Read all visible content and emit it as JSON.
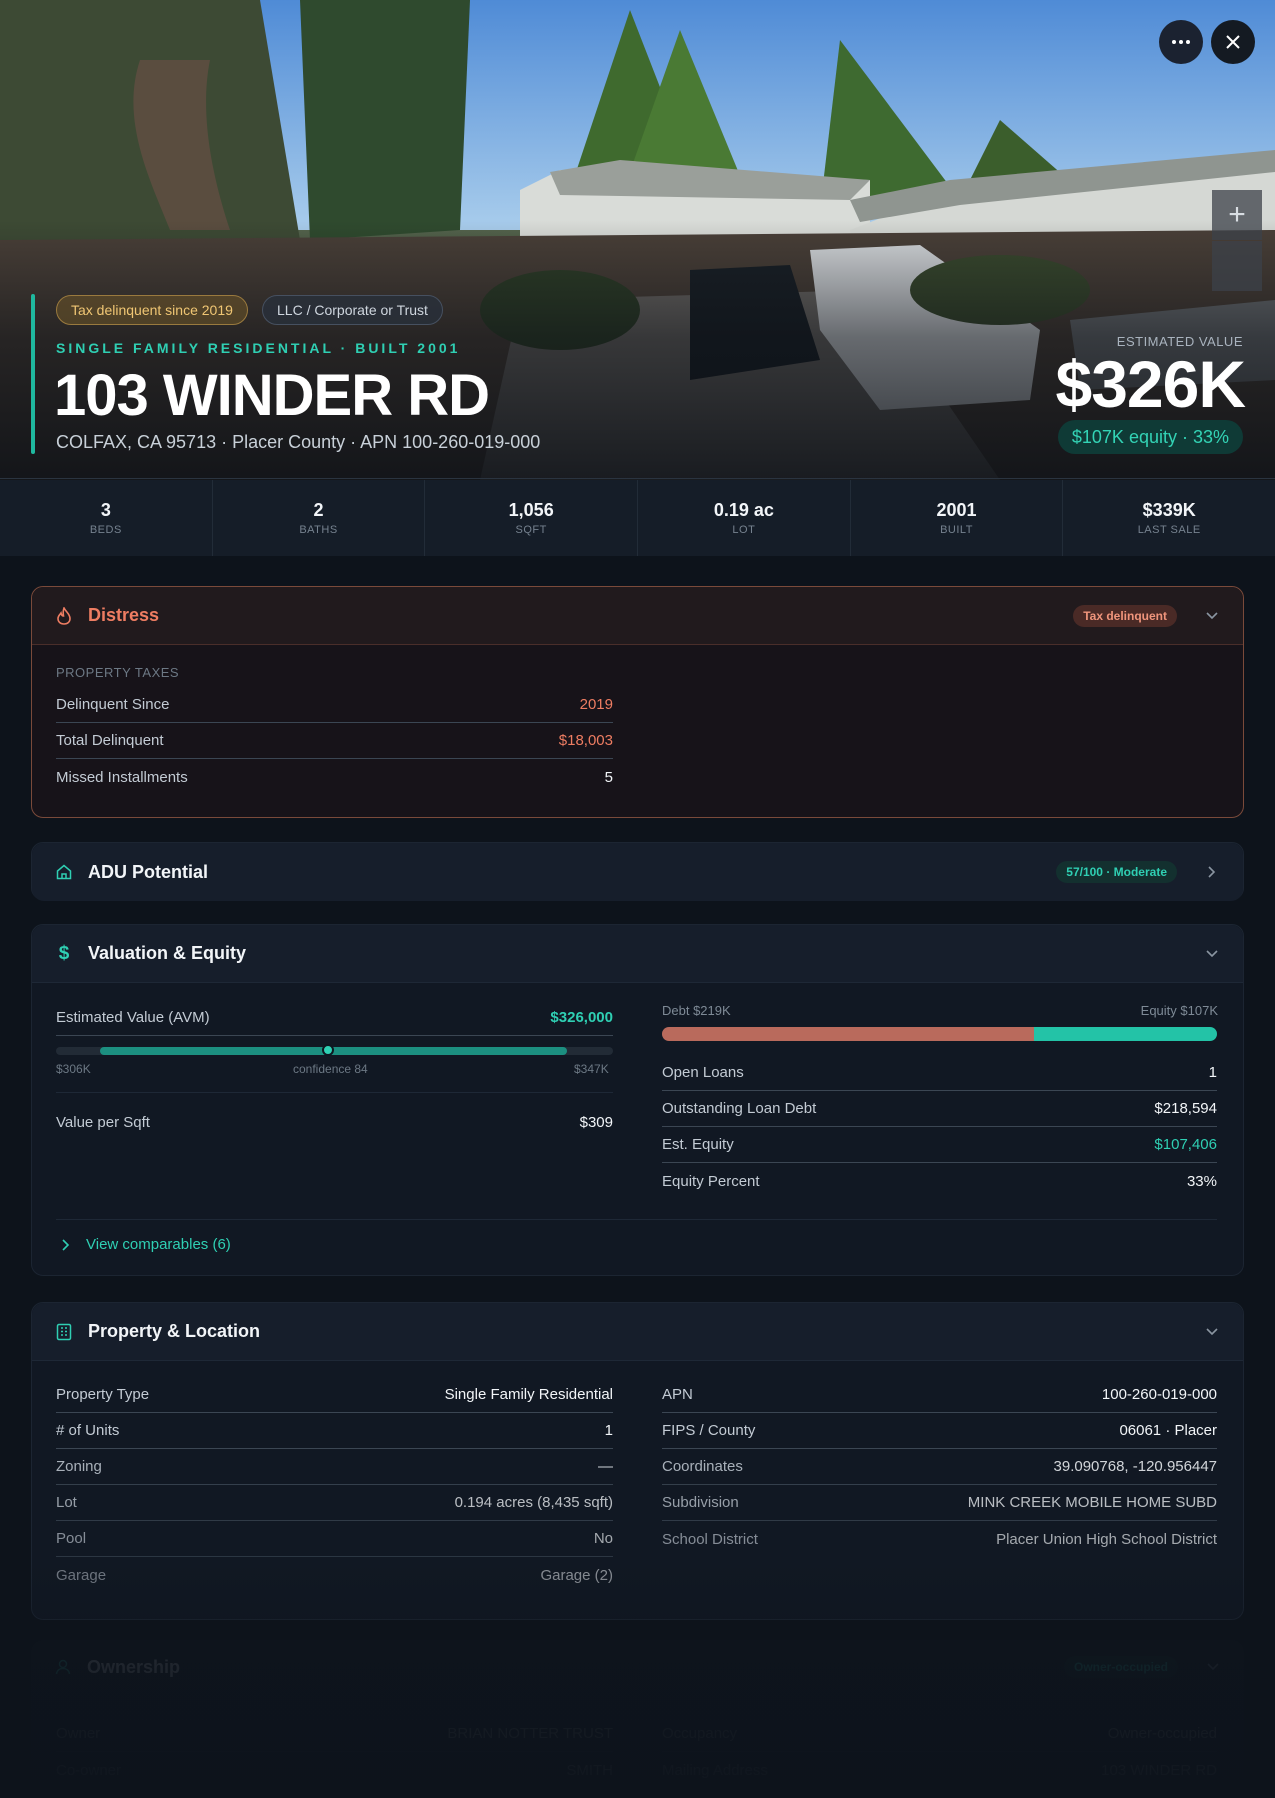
{
  "hero": {
    "tags": {
      "tax": "Tax delinquent since 2019",
      "owner_type": "LLC / Corporate or Trust"
    },
    "eyebrow": "SINGLE FAMILY RESIDENTIAL · BUILT 2001",
    "address": "103 WINDER RD",
    "subtitle": "COLFAX, CA 95713 · Placer County · APN 100-260-019-000",
    "estimated_label": "ESTIMATED VALUE",
    "estimated_value": "$326K",
    "equity_pill": "$107K equity · 33%"
  },
  "stats": [
    {
      "value": "3",
      "label": "BEDS"
    },
    {
      "value": "2",
      "label": "BATHS"
    },
    {
      "value": "1,056",
      "label": "SQFT"
    },
    {
      "value": "0.19 ac",
      "label": "LOT"
    },
    {
      "value": "2001",
      "label": "BUILT"
    },
    {
      "value": "$339K",
      "label": "LAST SALE"
    }
  ],
  "distress": {
    "title": "Distress",
    "badge": "Tax delinquent",
    "section": "PROPERTY TAXES",
    "rows": [
      {
        "k": "Delinquent Since",
        "v": "2019"
      },
      {
        "k": "Total Delinquent",
        "v": "$18,003"
      },
      {
        "k": "Missed Installments",
        "v": "5"
      }
    ]
  },
  "adu": {
    "title": "ADU Potential",
    "badge": "57/100 · Moderate"
  },
  "valuation": {
    "title": "Valuation & Equity",
    "avm_label": "Estimated Value (AVM)",
    "avm_value": "$326,000",
    "range_low": "$306K",
    "range_high": "$347K",
    "confidence": "confidence 84",
    "confidence_score": 84,
    "vps_label": "Value per Sqft",
    "vps_value": "$309",
    "debt_label": "Debt $219K",
    "equity_label": "Equity $107K",
    "debt_fraction": 0.67,
    "rows": [
      {
        "k": "Open Loans",
        "v": "1"
      },
      {
        "k": "Outstanding Loan Debt",
        "v": "$218,594"
      },
      {
        "k": "Est. Equity",
        "v": "$107,406"
      },
      {
        "k": "Equity Percent",
        "v": "33%"
      }
    ],
    "comparables_link": "View comparables (6)"
  },
  "property": {
    "title": "Property & Location",
    "left": [
      {
        "k": "Property Type",
        "v": "Single Family Residential"
      },
      {
        "k": "# of Units",
        "v": "1"
      },
      {
        "k": "Zoning",
        "v": "—"
      },
      {
        "k": "Lot",
        "v": "0.194 acres (8,435 sqft)"
      },
      {
        "k": "Pool",
        "v": "No"
      },
      {
        "k": "Garage",
        "v": "Garage (2)"
      }
    ],
    "right": [
      {
        "k": "APN",
        "v": "100-260-019-000"
      },
      {
        "k": "FIPS / County",
        "v": "06061 · Placer"
      },
      {
        "k": "Coordinates",
        "v": "39.090768, -120.956447"
      },
      {
        "k": "Subdivision",
        "v": "MINK CREEK MOBILE HOME SUBD"
      },
      {
        "k": "School District",
        "v": "Placer Union High School District"
      }
    ]
  },
  "ownership": {
    "title": "Ownership",
    "badge": "Owner-occupied",
    "rows": [
      {
        "k": "Owner",
        "v": "BRIAN NOTTER TRUST",
        "k2": "Occupancy",
        "v2": "Owner-occupied"
      },
      {
        "k": "Co-owner",
        "v": "SMITH",
        "k2": "Mailing Address",
        "v2": "103 WINDER RD"
      }
    ]
  },
  "colors": {
    "accent": "#2fcfb3",
    "danger": "#ee7d62",
    "debt": "#b96a5c"
  }
}
